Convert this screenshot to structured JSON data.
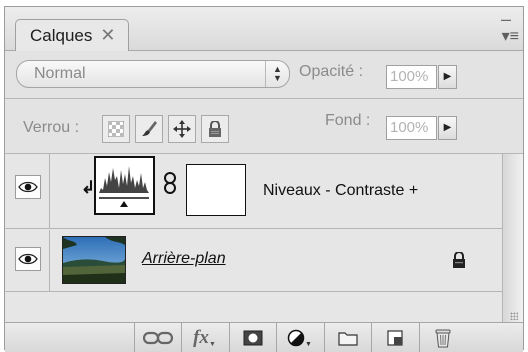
{
  "panel": {
    "tab_label": "Calques",
    "close_glyph": "✕",
    "collapse_glyph": "–",
    "menu_glyph": "▾≡"
  },
  "blend_mode": {
    "value": "Normal"
  },
  "opacity": {
    "label": "Opacité :",
    "value": "100%"
  },
  "lock": {
    "label": "Verrou :"
  },
  "fill": {
    "label": "Fond :",
    "value": "100%"
  },
  "layers": [
    {
      "name": "Niveaux - Contraste +",
      "type": "adjustment",
      "visible": true,
      "clipped": true
    },
    {
      "name": "Arrière-plan",
      "type": "background",
      "visible": true,
      "locked": true
    }
  ],
  "footer": {
    "icons": [
      "link-layers-icon",
      "layer-style-fx-icon",
      "add-mask-icon",
      "new-adjustment-layer-icon",
      "new-group-icon",
      "new-layer-icon",
      "delete-layer-icon"
    ],
    "fx_label": "fx"
  },
  "colors": {
    "panel_bg": "#e3e3e3",
    "field_bg": "#ffffff",
    "text": "#111111",
    "muted_text": "#8b8b8b"
  }
}
